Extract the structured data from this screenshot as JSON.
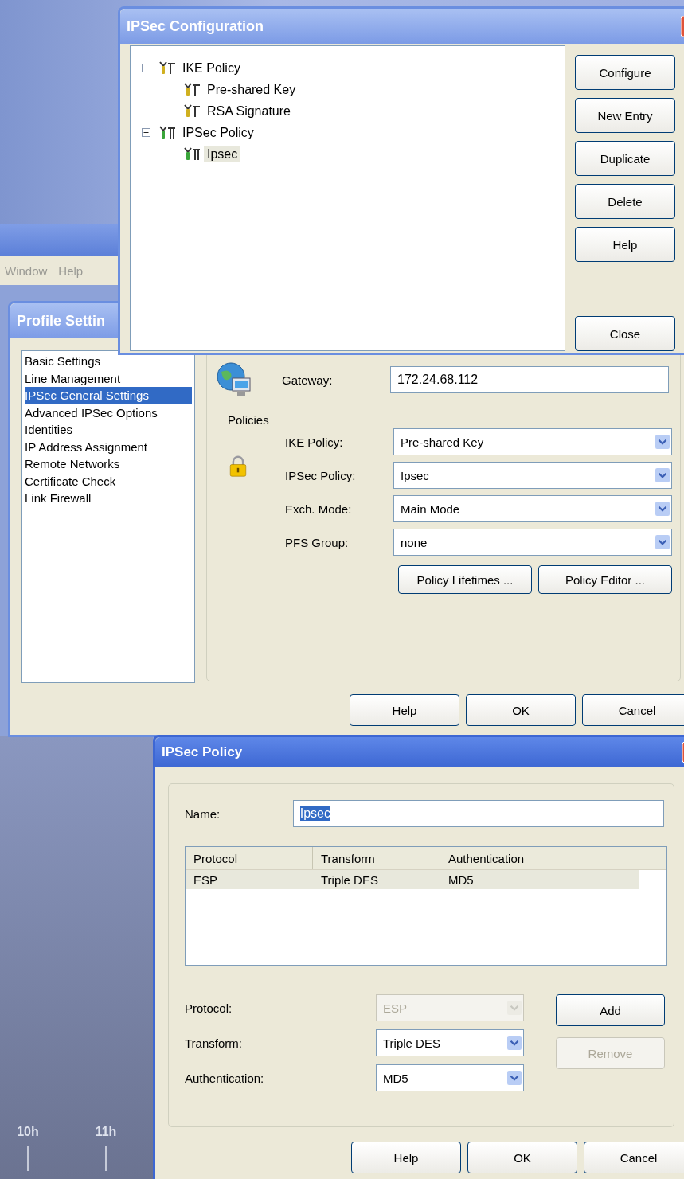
{
  "desktop": {
    "timeline_labels": [
      "10h",
      "11h"
    ]
  },
  "background_window": {
    "menu": [
      "Window",
      "Help"
    ]
  },
  "ipsec_configuration": {
    "title": "IPSec Configuration",
    "tree": [
      {
        "label": "IKE Policy",
        "kind": "ike",
        "expanded": true,
        "selected": false,
        "children": [
          {
            "label": "Pre-shared Key",
            "kind": "ike",
            "selected": false
          },
          {
            "label": "RSA Signature",
            "kind": "ike",
            "selected": false
          }
        ]
      },
      {
        "label": "IPSec Policy",
        "kind": "ipsec",
        "expanded": true,
        "selected": false,
        "children": [
          {
            "label": "Ipsec",
            "kind": "ipsec",
            "selected": true
          }
        ]
      }
    ],
    "buttons": [
      "Configure",
      "New Entry",
      "Duplicate",
      "Delete",
      "Help"
    ],
    "close_button": "Close"
  },
  "profile_settings": {
    "title": "Profile Settin",
    "nav": [
      {
        "label": "Basic Settings",
        "selected": false
      },
      {
        "label": "Line Management",
        "selected": false
      },
      {
        "label": "IPSec General Settings",
        "selected": true
      },
      {
        "label": "Advanced IPSec Options",
        "selected": false
      },
      {
        "label": "Identities",
        "selected": false
      },
      {
        "label": "IP Address Assignment",
        "selected": false
      },
      {
        "label": "Remote Networks",
        "selected": false
      },
      {
        "label": "Certificate Check",
        "selected": false
      },
      {
        "label": "Link Firewall",
        "selected": false
      }
    ],
    "gateway": {
      "label": "Gateway:",
      "value": "172.24.68.112"
    },
    "policies_heading": "Policies",
    "policies": [
      {
        "label": "IKE Policy:",
        "value": "Pre-shared Key"
      },
      {
        "label": "IPSec Policy:",
        "value": "Ipsec"
      },
      {
        "label": "Exch. Mode:",
        "value": "Main Mode"
      },
      {
        "label": "PFS Group:",
        "value": "none"
      }
    ],
    "policy_buttons": [
      "Policy Lifetimes ...",
      "Policy Editor ..."
    ],
    "buttons": [
      "Help",
      "OK",
      "Cancel"
    ]
  },
  "ipsec_policy": {
    "title": "IPSec Policy",
    "name": {
      "label": "Name:",
      "value": "Ipsec",
      "text_selected": true
    },
    "table": {
      "columns": [
        "Protocol",
        "Transform",
        "Authentication"
      ],
      "rows": [
        {
          "cells": [
            "ESP",
            "Triple DES",
            "MD5"
          ],
          "selected": true
        }
      ]
    },
    "fields": [
      {
        "label": "Protocol:",
        "value": "ESP",
        "disabled": true
      },
      {
        "label": "Transform:",
        "value": "Triple DES",
        "disabled": false
      },
      {
        "label": "Authentication:",
        "value": "MD5",
        "disabled": false
      }
    ],
    "side_buttons": [
      {
        "label": "Add",
        "disabled": false
      },
      {
        "label": "Remove",
        "disabled": true
      }
    ],
    "buttons": [
      "Help",
      "OK",
      "Cancel"
    ]
  }
}
